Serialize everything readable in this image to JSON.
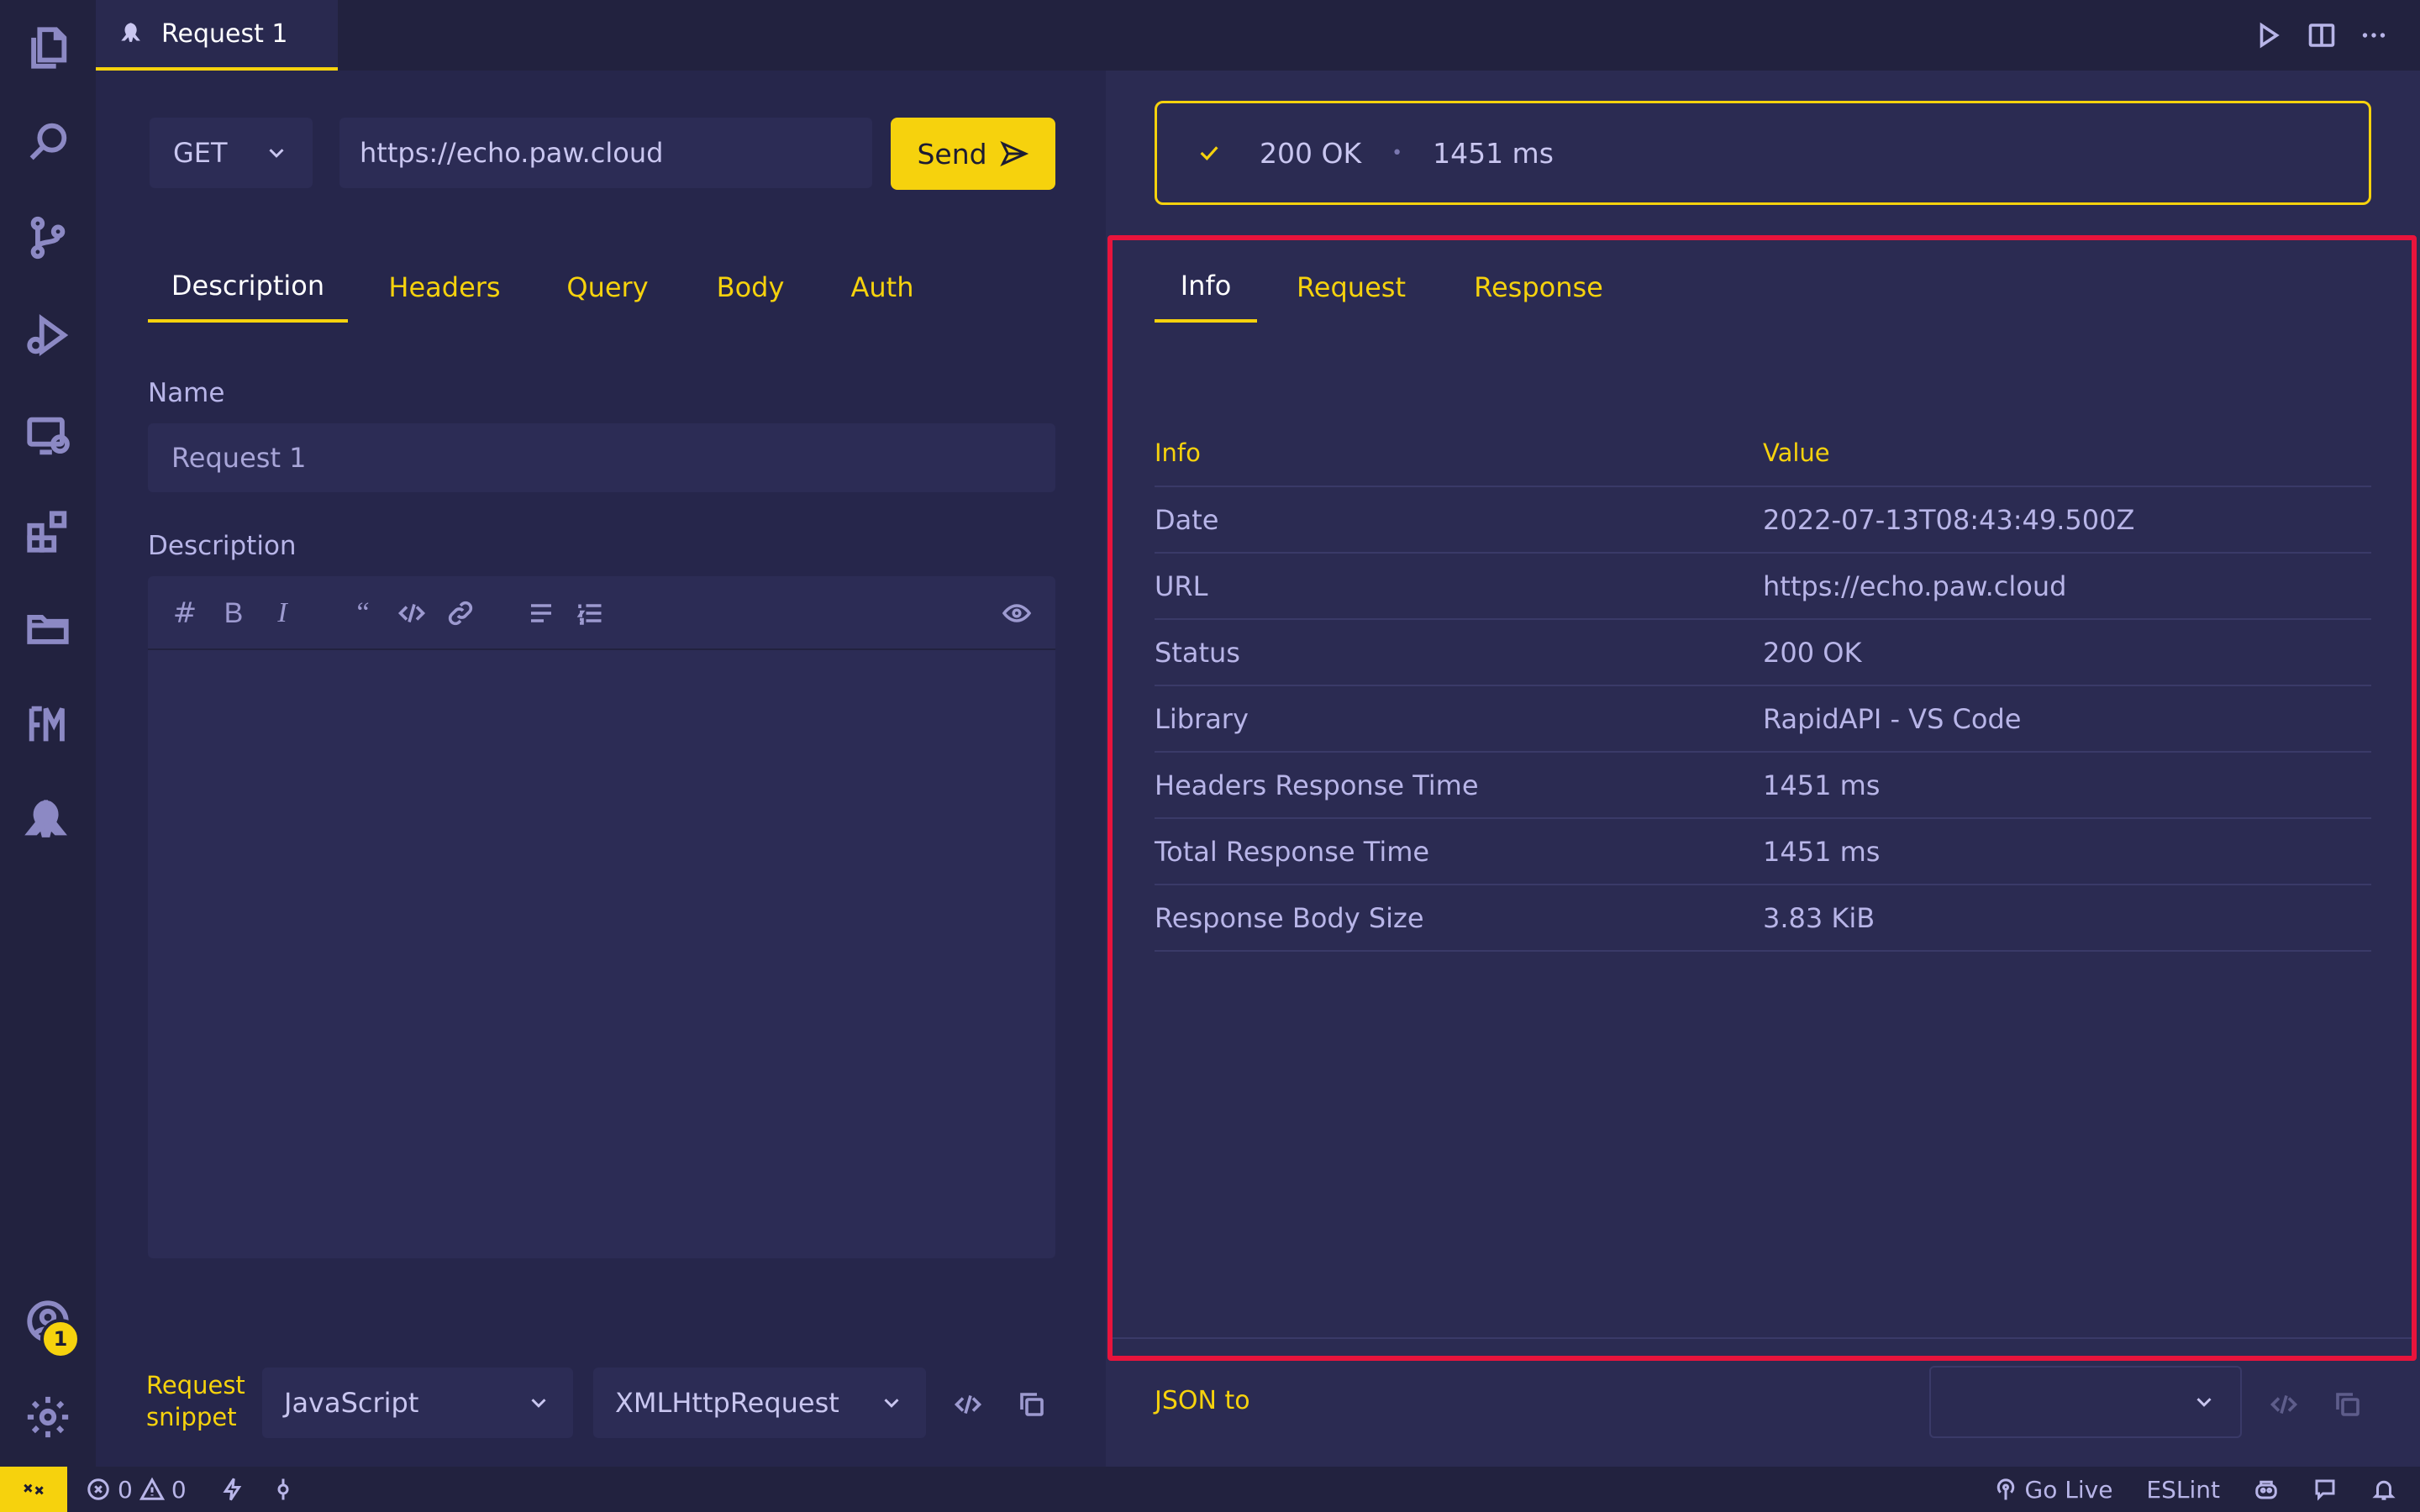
{
  "editor": {
    "tab_title": "Request 1"
  },
  "request": {
    "method": "GET",
    "url": "https://echo.paw.cloud",
    "send_label": "Send",
    "tabs": [
      {
        "label": "Description",
        "active": true
      },
      {
        "label": "Headers",
        "active": false
      },
      {
        "label": "Query",
        "active": false
      },
      {
        "label": "Body",
        "active": false
      },
      {
        "label": "Auth",
        "active": false
      }
    ],
    "name_label": "Name",
    "name_value": "Request 1",
    "description_label": "Description",
    "snippet_label": "Request snippet",
    "snippet_language": "JavaScript",
    "snippet_library": "XMLHttpRequest"
  },
  "response": {
    "status": "200 OK",
    "time": "1451 ms",
    "tabs": [
      {
        "label": "Info",
        "active": true
      },
      {
        "label": "Request",
        "active": false
      },
      {
        "label": "Response",
        "active": false
      }
    ],
    "table": {
      "headers": [
        "Info",
        "Value"
      ],
      "rows": [
        [
          "Date",
          "2022-07-13T08:43:49.500Z"
        ],
        [
          "URL",
          "https://echo.paw.cloud"
        ],
        [
          "Status",
          "200 OK"
        ],
        [
          "Library",
          "RapidAPI - VS Code"
        ],
        [
          "Headers Response Time",
          "1451 ms"
        ],
        [
          "Total Response Time",
          "1451 ms"
        ],
        [
          "Response Body Size",
          "3.83 KiB"
        ]
      ]
    },
    "json_to_label": "JSON to"
  },
  "status_bar": {
    "errors": "0",
    "warnings": "0",
    "go_live": "Go Live",
    "eslint": "ESLint"
  },
  "account_badge": "1",
  "colors": {
    "accent": "#f6d20d",
    "highlight": "#e8143c",
    "background": "#24244a"
  }
}
